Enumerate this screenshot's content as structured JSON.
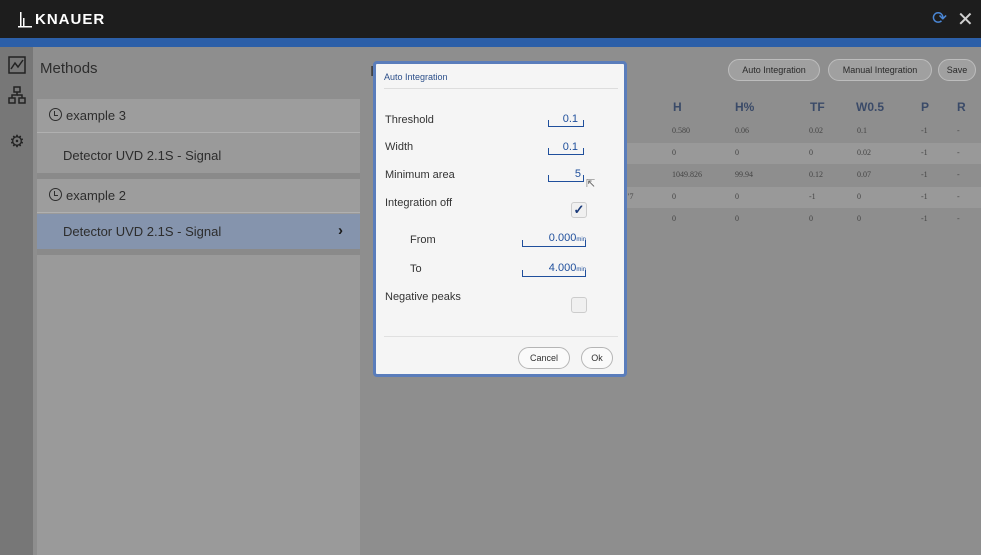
{
  "app": {
    "brand": "KNAUER"
  },
  "colors": {
    "titlebar": "#1d1d1d",
    "accent": "#2c5fa8",
    "selected_row": "#8594ad",
    "dialog_border": "#5a7dbb",
    "value_blue": "#1f4f9c"
  },
  "rail": {
    "icons": [
      "chart-icon",
      "network-icon",
      "gear-icon"
    ]
  },
  "methods": {
    "title": "Methods",
    "groups": [
      {
        "name": "example 3",
        "signal": "Detector UVD 2.1S - Signal",
        "selected": false
      },
      {
        "name": "example 2",
        "signal": "Detector UVD 2.1S - Signal",
        "selected": true
      }
    ]
  },
  "integration": {
    "heading_partial": "Ir",
    "buttons": {
      "auto": "Auto Integration",
      "manual": "Manual Integration",
      "save": "Save"
    }
  },
  "table": {
    "headers": [
      "H",
      "H%",
      "TF",
      "W0.5",
      "P",
      "R"
    ],
    "rows": [
      [
        "0.580",
        "0.06",
        "0.02",
        "0.1",
        "-1",
        "-"
      ],
      [
        "0",
        "0",
        "0",
        "0.02",
        "-1",
        "-"
      ],
      [
        "1049.826",
        "99.94",
        "0.12",
        "0.07",
        "-1",
        "-"
      ],
      [
        "0",
        "0",
        "-1",
        "0",
        "-1",
        "-"
      ],
      [
        "0",
        "0",
        "0",
        "0",
        "-1",
        "-"
      ]
    ],
    "partial_left_value": "'7"
  },
  "dialog": {
    "title": "Auto Integration",
    "threshold": {
      "label": "Threshold",
      "value": "0.1"
    },
    "width": {
      "label": "Width",
      "value": "0.1"
    },
    "minimum_area": {
      "label": "Minimum area",
      "value": "5"
    },
    "integration_off": {
      "label": "Integration off",
      "checked": true
    },
    "from": {
      "label": "From",
      "value": "0.000",
      "unit": "min"
    },
    "to": {
      "label": "To",
      "value": "4.000",
      "unit": "min"
    },
    "negative_peaks": {
      "label": "Negative peaks",
      "checked": false
    },
    "cancel": "Cancel",
    "ok": "Ok"
  }
}
